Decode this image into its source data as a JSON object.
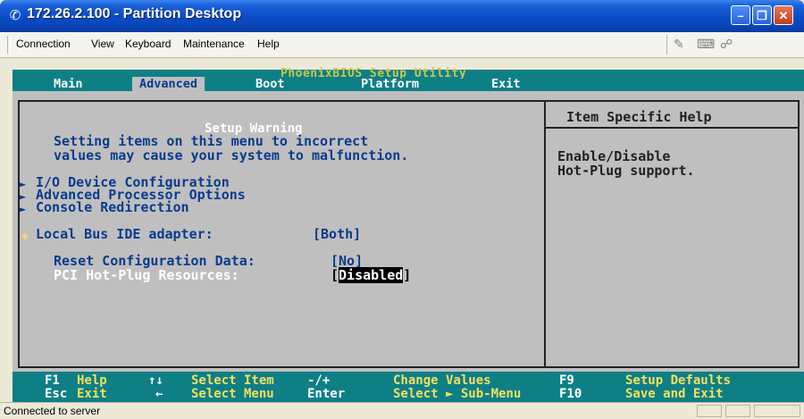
{
  "window": {
    "title": "172.26.2.100 - Partition Desktop",
    "min_glyph": "–",
    "max_glyph": "❐",
    "close_glyph": "✕"
  },
  "menubar": {
    "items": [
      "Connection",
      "View",
      "Keyboard",
      "Maintenance",
      "Help"
    ],
    "tool_icons": [
      "connect-icon",
      "keyboard-icon",
      "network-icon"
    ]
  },
  "bios": {
    "utility_title": "PhoenixBIOS Setup Utility",
    "tabs": [
      "Main",
      "Advanced",
      "Boot",
      "Platform",
      "Exit"
    ],
    "active_tab": "Advanced",
    "warning_title": "Setup Warning",
    "warning_lines": [
      "Setting items on this menu to incorrect",
      "values may cause your system to malfunction."
    ],
    "submenus": [
      "I/O Device Configuration",
      "Advanced Processor Options",
      "Console Redirection"
    ],
    "settings": [
      {
        "label": "Local Bus IDE adapter:",
        "value": "Both"
      },
      {
        "label": "Reset Configuration Data:",
        "value": "No"
      },
      {
        "label": "PCI Hot-Plug Resources:",
        "value": "Disabled"
      }
    ],
    "help_title": "Item Specific Help",
    "help_lines": [
      "Enable/Disable",
      "Hot-Plug support."
    ],
    "footer": {
      "row1": [
        {
          "key": "F1",
          "desc": "Help"
        },
        {
          "key": "↑↓",
          "desc": "Select Item"
        },
        {
          "key": "-/+",
          "desc": "Change Values"
        },
        {
          "key": "F9",
          "desc": "Setup Defaults"
        }
      ],
      "row2": [
        {
          "key": "Esc",
          "desc": "Exit"
        },
        {
          "key": "←",
          "desc": "Select Menu"
        },
        {
          "key": "Enter",
          "desc": "Select ► Sub-Menu"
        },
        {
          "key": "F10",
          "desc": "Save and Exit"
        }
      ]
    },
    "colors": {
      "background": "#bfbfbf",
      "bar": "#0f7f86",
      "text": "#0a3c8c",
      "highlight": "#f0e060"
    }
  },
  "status": {
    "text": "Connected to server"
  }
}
